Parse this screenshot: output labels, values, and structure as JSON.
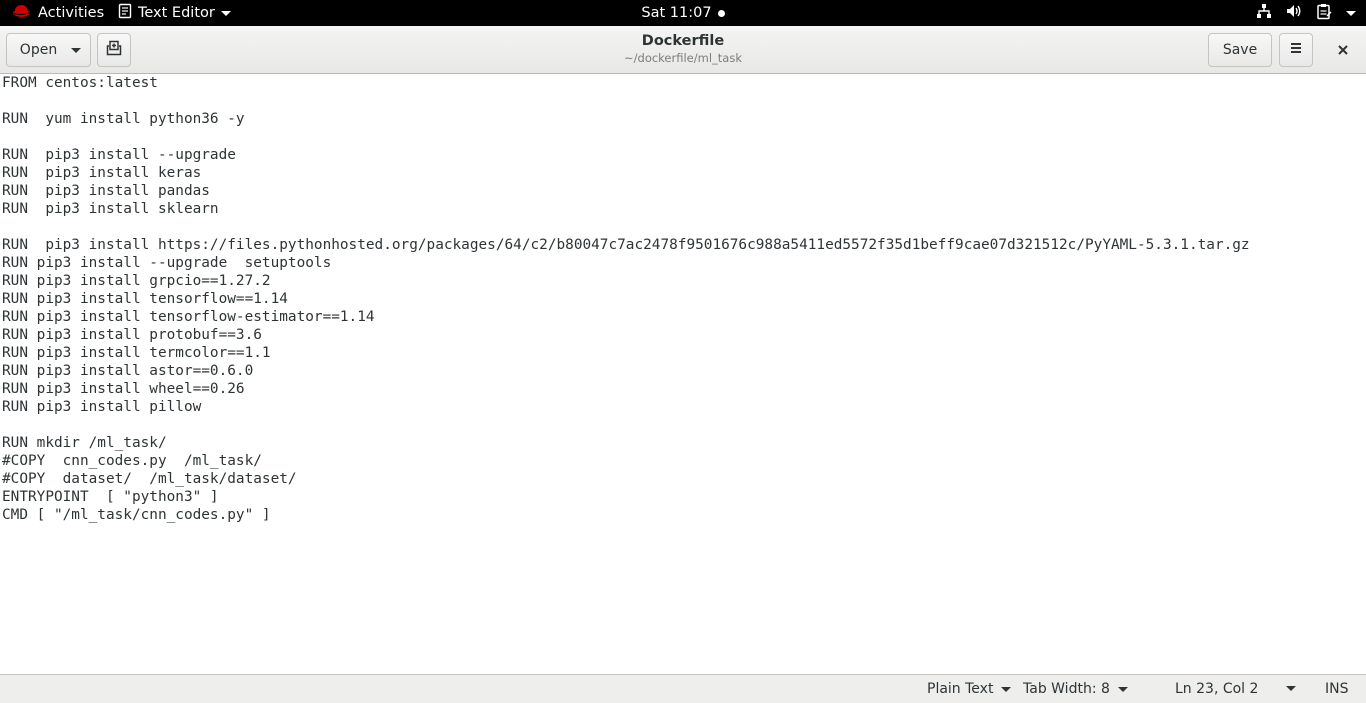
{
  "topbar": {
    "activities_label": "Activities",
    "app_menu_label": "Text Editor",
    "clock": "Sat 11:07",
    "status_icons": [
      "network-icon",
      "volume-icon",
      "clipboard-icon"
    ],
    "accent_color": "#cc0000"
  },
  "header": {
    "open_label": "Open",
    "save_label": "Save",
    "title": "Dockerfile",
    "subtitle": "~/dockerfile/ml_task"
  },
  "editor": {
    "lines": [
      "FROM centos:latest",
      "",
      "RUN  yum install python36 -y",
      "",
      "RUN  pip3 install --upgrade",
      "RUN  pip3 install keras",
      "RUN  pip3 install pandas",
      "RUN  pip3 install sklearn",
      "",
      "RUN  pip3 install https://files.pythonhosted.org/packages/64/c2/b80047c7ac2478f9501676c988a5411ed5572f35d1beff9cae07d321512c/PyYAML-5.3.1.tar.gz",
      "RUN pip3 install --upgrade  setuptools",
      "RUN pip3 install grpcio==1.27.2",
      "RUN pip3 install tensorflow==1.14",
      "RUN pip3 install tensorflow-estimator==1.14",
      "RUN pip3 install protobuf==3.6",
      "RUN pip3 install termcolor==1.1",
      "RUN pip3 install astor==0.6.0",
      "RUN pip3 install wheel==0.26",
      "RUN pip3 install pillow",
      "",
      "RUN mkdir /ml_task/",
      "#COPY  cnn_codes.py  /ml_task/",
      "#COPY  dataset/  /ml_task/dataset/",
      "ENTRYPOINT  [ \"python3\" ]",
      "CMD [ \"/ml_task/cnn_codes.py\" ]"
    ]
  },
  "statusbar": {
    "language": "Plain Text",
    "tab_width": "Tab Width: 8",
    "position": "Ln 23, Col 2",
    "mode": "INS"
  }
}
